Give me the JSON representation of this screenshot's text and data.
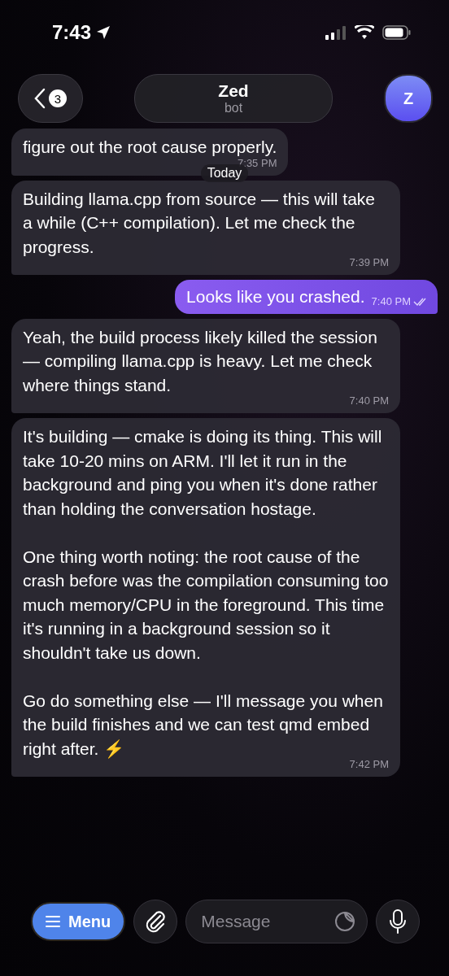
{
  "status_bar": {
    "time": "7:43"
  },
  "header": {
    "back_count": "3",
    "title": "Zed",
    "subtitle": "bot",
    "avatar_letter": "Z"
  },
  "messages": [
    {
      "kind": "incoming",
      "paragraphs": [
        "figure out the root cause properly."
      ],
      "time": "7:35 PM"
    },
    {
      "kind": "date",
      "label": "Today"
    },
    {
      "kind": "incoming",
      "paragraphs": [
        "Building llama.cpp from source — this will take a while (C++ compilation). Let me check the progress."
      ],
      "time": "7:39 PM"
    },
    {
      "kind": "outgoing",
      "paragraphs": [
        "Looks like you crashed."
      ],
      "time": "7:40 PM",
      "read": true
    },
    {
      "kind": "incoming",
      "paragraphs": [
        "Yeah, the build process likely killed the session — compiling llama.cpp is heavy. Let me check where things stand."
      ],
      "time": "7:40 PM"
    },
    {
      "kind": "incoming",
      "paragraphs": [
        "It's building — cmake is doing its thing. This will take 10-20 mins on ARM. I'll let it run in the background and ping you when it's done rather than holding the conversation hostage.",
        "One thing worth noting: the root cause of the crash before was the compilation consuming too much memory/CPU in the foreground. This time it's running in a background session so it shouldn't take us down.",
        "Go do something else — I'll message you when the build finishes and we can test qmd embed right after. ⚡"
      ],
      "time": "7:42 PM"
    }
  ],
  "composer": {
    "menu_label": "Menu",
    "placeholder": "Message"
  }
}
